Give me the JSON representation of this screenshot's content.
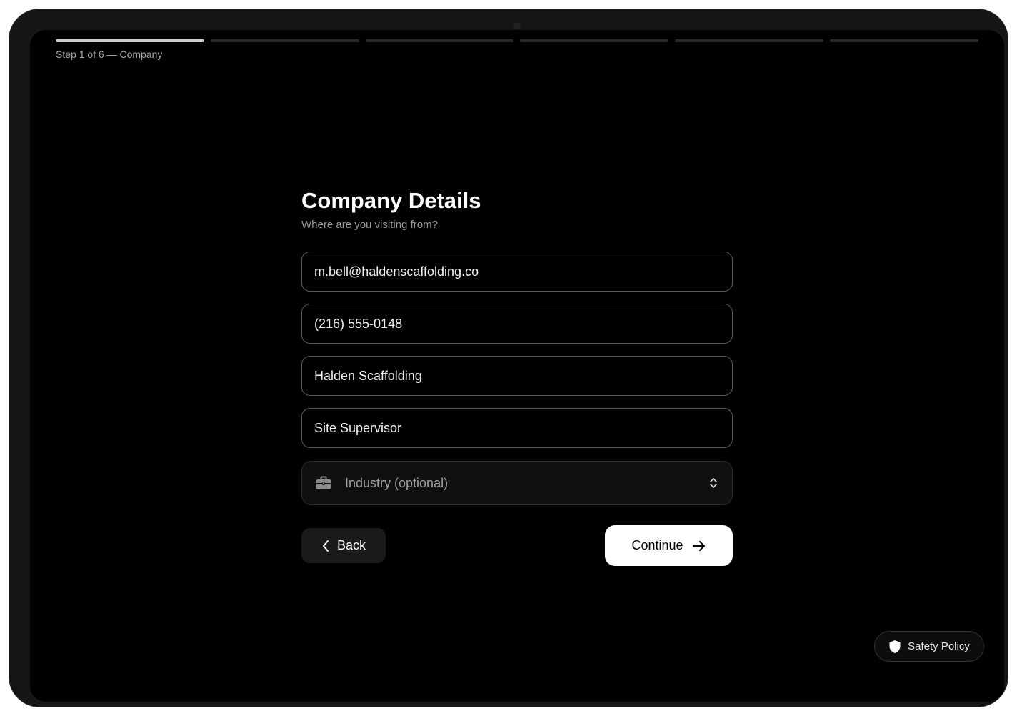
{
  "progress": {
    "total_steps": 6,
    "current_step": 1,
    "label": "Step 1 of 6 — Company"
  },
  "form": {
    "title": "Company Details",
    "subtitle": "Where are you visiting from?",
    "fields": [
      {
        "value": "m.bell@haldenscaffolding.co"
      },
      {
        "value": "(216) 555-0148"
      },
      {
        "value": "Halden Scaffolding"
      },
      {
        "value": "Site Supervisor"
      }
    ],
    "industry_select": {
      "placeholder": "Industry (optional)",
      "icon": "briefcase-icon"
    }
  },
  "actions": {
    "back_label": "Back",
    "continue_label": "Continue"
  },
  "footer": {
    "safety_label": "Safety Policy",
    "safety_icon": "shield-icon"
  },
  "colors": {
    "background": "#000000",
    "primary_button": "#ffffff",
    "active_progress": "#c9c9c9"
  }
}
